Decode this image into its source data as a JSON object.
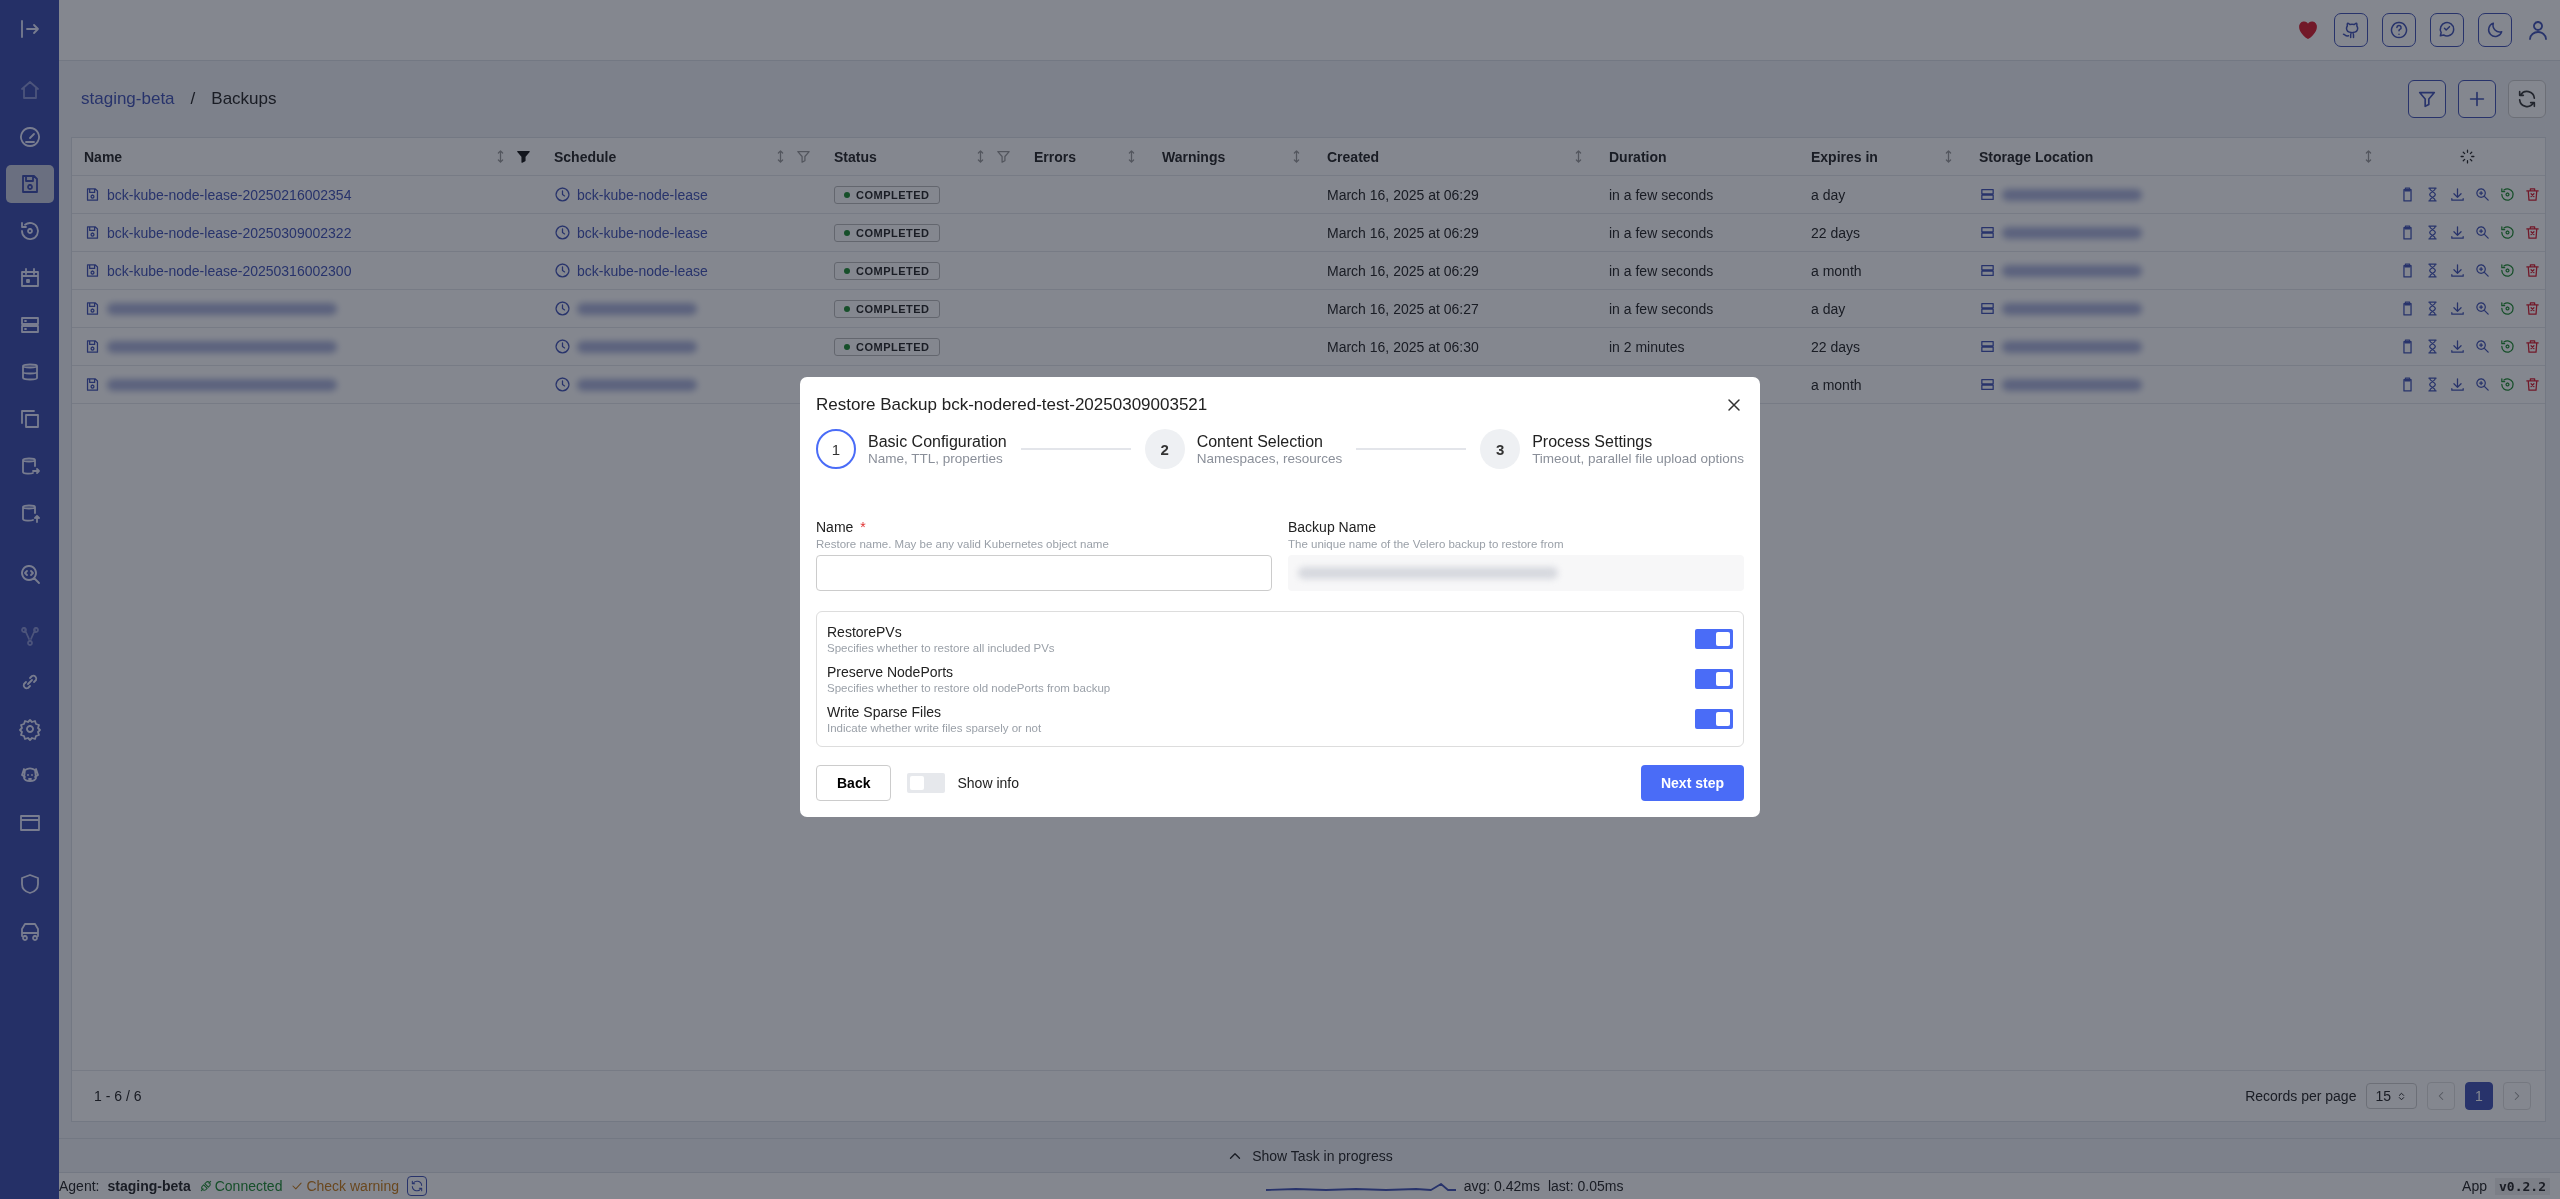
{
  "sidebar": {
    "items": [
      {
        "selected": false,
        "disabled": false
      },
      {
        "selected": false,
        "disabled": true
      },
      {
        "selected": false,
        "disabled": false
      },
      {
        "selected": true,
        "disabled": false
      },
      {
        "selected": false,
        "disabled": false
      },
      {
        "selected": false,
        "disabled": false
      },
      {
        "selected": false,
        "disabled": false
      },
      {
        "selected": false,
        "disabled": false
      },
      {
        "selected": false,
        "disabled": false
      },
      {
        "selected": false,
        "disabled": false
      },
      {
        "selected": false,
        "disabled": false
      },
      {
        "selected": false,
        "disabled": false
      },
      {
        "selected": false,
        "disabled": true
      },
      {
        "selected": false,
        "disabled": false
      },
      {
        "selected": false,
        "disabled": false
      },
      {
        "selected": false,
        "disabled": false
      },
      {
        "selected": false,
        "disabled": false
      },
      {
        "selected": false,
        "disabled": false
      },
      {
        "selected": false,
        "disabled": false
      }
    ]
  },
  "breadcrumb": {
    "parent": "staging-beta",
    "separator": "/",
    "current": "Backups"
  },
  "table": {
    "columns": [
      {
        "label": "Name",
        "sortable": true,
        "filtered": true
      },
      {
        "label": "Schedule",
        "sortable": true,
        "filtered": false
      },
      {
        "label": "Status",
        "sortable": true,
        "filtered": false
      },
      {
        "label": "Errors",
        "sortable": true
      },
      {
        "label": "Warnings",
        "sortable": true
      },
      {
        "label": "Created",
        "sortable": true
      },
      {
        "label": "Duration",
        "sortable": false
      },
      {
        "label": "Expires in",
        "sortable": true
      },
      {
        "label": "Storage Location",
        "sortable": true
      }
    ],
    "rows": [
      {
        "name": "bck-kube-node-lease-20250216002354",
        "schedule": "bck-kube-node-lease",
        "status": "COMPLETED",
        "created": "March 16, 2025 at 06:29",
        "duration": "in a few seconds",
        "expires": "a day"
      },
      {
        "name": "bck-kube-node-lease-20250309002322",
        "schedule": "bck-kube-node-lease",
        "status": "COMPLETED",
        "created": "March 16, 2025 at 06:29",
        "duration": "in a few seconds",
        "expires": "22 days"
      },
      {
        "name": "bck-kube-node-lease-20250316002300",
        "schedule": "bck-kube-node-lease",
        "status": "COMPLETED",
        "created": "March 16, 2025 at 06:29",
        "duration": "in a few seconds",
        "expires": "a month"
      },
      {
        "status": "COMPLETED",
        "created": "March 16, 2025 at 06:27",
        "duration": "in a few seconds",
        "expires": "a day"
      },
      {
        "status": "COMPLETED",
        "created": "March 16, 2025 at 06:30",
        "duration": "in 2 minutes",
        "expires": "22 days"
      },
      {
        "expires": "a month"
      }
    ],
    "range": "1 - 6 / 6",
    "records_label": "Records per page",
    "records_value": "15",
    "pages": [
      {
        "label": "1",
        "selected": true
      }
    ]
  },
  "task_bar": {
    "label": "Show Task in progress"
  },
  "status_bar": {
    "agent_label": "Agent:",
    "agent": "staging-beta",
    "connection": "Connected",
    "check": "Check warning",
    "avg": "avg: 0.42ms",
    "last": "last: 0.05ms",
    "app": "App",
    "version": "v0.2.2"
  },
  "dialog": {
    "title": "Restore Backup bck-nodered-test-20250309003521",
    "steps": [
      {
        "number": "1",
        "title": "Basic Configuration",
        "subtitle": "Name, TTL, properties",
        "selected": true
      },
      {
        "number": "2",
        "title": "Content Selection",
        "subtitle": "Namespaces, resources",
        "selected": false
      },
      {
        "number": "3",
        "title": "Process Settings",
        "subtitle": "Timeout, parallel file upload options",
        "selected": false
      }
    ],
    "name_field": {
      "label": "Name",
      "required_mark": "*",
      "hint": "Restore name. May be any valid Kubernetes object name"
    },
    "backup_field": {
      "label": "Backup Name",
      "hint": "The unique name of the Velero backup to restore from"
    },
    "options": [
      {
        "title": "RestorePVs",
        "description": "Specifies whether to restore all included PVs",
        "on": true
      },
      {
        "title": "Preserve NodePorts",
        "description": "Specifies whether to restore old nodePorts from backup",
        "on": true
      },
      {
        "title": "Write Sparse Files",
        "description": "Indicate whether write files sparsely or not",
        "on": true
      }
    ],
    "back": "Back",
    "show_info": {
      "label": "Show info",
      "on": false
    },
    "next": "Next step"
  }
}
